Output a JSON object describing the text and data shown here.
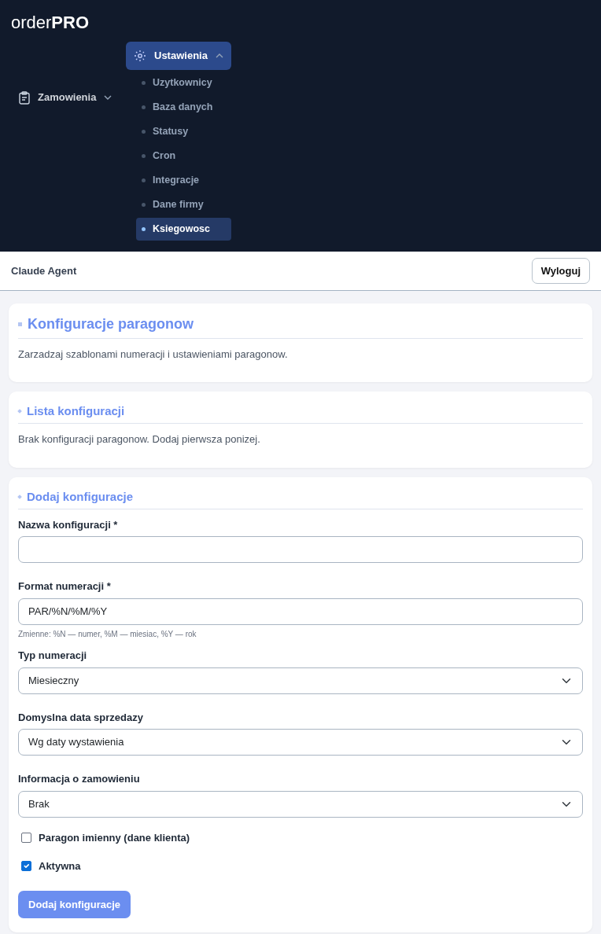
{
  "logo": {
    "light": "order",
    "bold": "PRO"
  },
  "nav": [
    {
      "label": "Zamowienia",
      "kind": "clipboard",
      "expanded": false,
      "selected": false
    },
    {
      "label": "Ustawienia",
      "kind": "gear",
      "expanded": true,
      "selected": true,
      "children": [
        {
          "label": "Uzytkownicy",
          "selected": false
        },
        {
          "label": "Baza danych",
          "selected": false
        },
        {
          "label": "Statusy",
          "selected": false
        },
        {
          "label": "Cron",
          "selected": false
        },
        {
          "label": "Integracje",
          "selected": false
        },
        {
          "label": "Dane firmy",
          "selected": false
        },
        {
          "label": "Ksiegowosc",
          "selected": true
        }
      ]
    }
  ],
  "topbar": {
    "user": "Claude Agent",
    "logout": "Wyloguj"
  },
  "cards": [
    {
      "title": "Konfiguracje paragonow",
      "text": "Zarzadzaj szablonami numeracji i ustawieniami paragonow."
    },
    {
      "title": "Lista konfiguracji",
      "text": "Brak konfiguracji paragonow. Dodaj pierwsza ponizej."
    }
  ],
  "form": {
    "title": "Dodaj konfiguracje",
    "fields": [
      {
        "kind": "text",
        "label": "Nazwa konfiguracji *"
      },
      {
        "kind": "text",
        "label": "Format numeracji *",
        "value": "PAR/%N/%M/%Y",
        "hint": "Zmienne: %N — numer, %M — miesiac, %Y — rok"
      },
      {
        "kind": "select",
        "label": "Typ numeracji",
        "value": "Miesieczny"
      },
      {
        "kind": "select",
        "label": "Domyslna data sprzedazy",
        "value": "Wg daty wystawienia"
      },
      {
        "kind": "select",
        "label": "Informacja o zamowieniu",
        "value": "Brak"
      },
      {
        "kind": "checkbox",
        "label": "Paragon imienny (dane klienta)",
        "checked": false
      },
      {
        "kind": "checkbox",
        "label": "Aktywna",
        "checked": true
      }
    ],
    "submit": "Dodaj konfiguracje"
  }
}
